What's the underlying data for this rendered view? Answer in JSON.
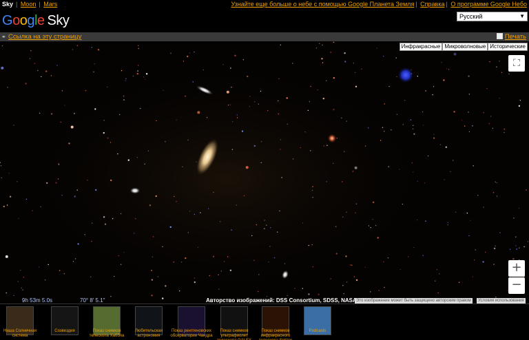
{
  "topnav": {
    "current": "Sky",
    "links": [
      "Moon",
      "Mars"
    ],
    "right_links": [
      "Узнайте еще больше о небе с помощью Google Планета Земля",
      "Справка",
      "О программе Google Небо"
    ]
  },
  "logo": {
    "g1": "G",
    "g2": "o",
    "g3": "o",
    "g4": "g",
    "g5": "l",
    "g6": "e",
    "sky": "Sky"
  },
  "language": {
    "selected": "Русский"
  },
  "linkbar": {
    "link": "Ссылка на эту страницу",
    "print": "Печать"
  },
  "layers": [
    "Инфракрасные",
    "Микроволновые",
    "Исторические"
  ],
  "coords": {
    "ra": "9h 53m 5.0s",
    "dec": "70° 8' 5.1\""
  },
  "credit": "Авторство изображений: DSS Consortium, SDSS, NASA/ESA",
  "notice": "Это изображение может быть защищено авторским правом",
  "terms": "Условия использования",
  "tours": [
    {
      "label": "Наша Солнечная система",
      "color": "#3a2a1a"
    },
    {
      "label": "Созвездия",
      "color": "#151515"
    },
    {
      "label": "Показ снимков телескопа Хаббла",
      "color": "#556b2f"
    },
    {
      "label": "Любительская астрономия",
      "color": "#101418"
    },
    {
      "label": "Показ рентгеновских обсерватории Чандра",
      "color": "#1a1030"
    },
    {
      "label": "Показ снимков ультрафиолет телескопа GALEX",
      "color": "#111"
    },
    {
      "label": "Показ снимков инфракрасного телескопа Spitzer",
      "color": "#2a1205"
    },
    {
      "label": "Podcasts",
      "color": "#3a6ea5"
    }
  ]
}
